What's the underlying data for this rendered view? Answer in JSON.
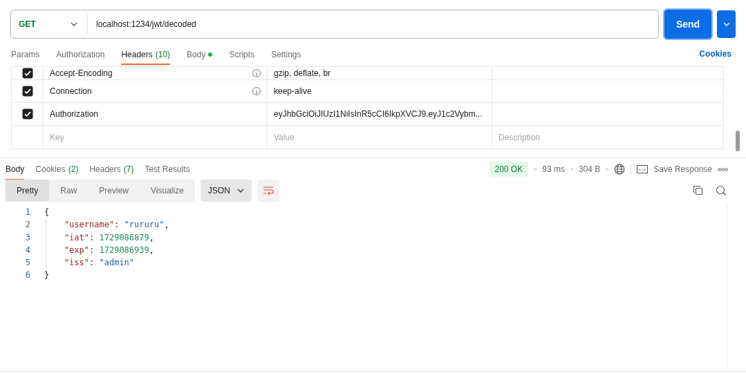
{
  "request": {
    "method": "GET",
    "url": "localhost:1234/jwt/decoded",
    "send": "Send"
  },
  "request_tabs": [
    {
      "label": "Params",
      "dot": false,
      "selected": false
    },
    {
      "label": "Authorization",
      "dot": false,
      "selected": false
    },
    {
      "label": "Headers",
      "count": "(10)",
      "dot": false,
      "selected": true
    },
    {
      "label": "Body",
      "dot": true,
      "selected": false
    },
    {
      "label": "Scripts",
      "dot": false,
      "selected": false
    },
    {
      "label": "Settings",
      "dot": false,
      "selected": false
    }
  ],
  "cookies_link": "Cookies",
  "headers": [
    {
      "checked": true,
      "key": "Accept-Encoding",
      "info": true,
      "value": "gzip, deflate, br"
    },
    {
      "checked": true,
      "key": "Connection",
      "info": true,
      "value": "keep-alive"
    },
    {
      "checked": true,
      "key": "Authorization",
      "info": false,
      "value": "eyJhbGciOiJIUzI1NiIsInR5cCI6IkpXVCJ9.eyJ1c2Vybm..."
    }
  ],
  "new_header": {
    "key_placeholder": "Key",
    "value_placeholder": "Value",
    "description_placeholder": "Description"
  },
  "response_tabs": [
    {
      "label": "Body",
      "selected": true
    },
    {
      "label": "Cookies",
      "count": "(2)",
      "selected": false
    },
    {
      "label": "Headers",
      "count": "(7)",
      "selected": false
    },
    {
      "label": "Test Results",
      "selected": false
    }
  ],
  "status": {
    "code": "200 OK",
    "time": "93 ms",
    "size": "304 B",
    "save": "Save Response"
  },
  "view_modes": [
    {
      "label": "Pretty",
      "selected": true
    },
    {
      "label": "Raw",
      "selected": false
    },
    {
      "label": "Preview",
      "selected": false
    },
    {
      "label": "Visualize",
      "selected": false
    }
  ],
  "format": "JSON",
  "code_lines": [
    [
      {
        "kind": "punct",
        "text": "{"
      }
    ],
    [
      {
        "kind": "key",
        "text": "    \"username\""
      },
      {
        "kind": "punct",
        "text": ": "
      },
      {
        "kind": "string",
        "text": "\"rururu\""
      },
      {
        "kind": "punct",
        "text": ","
      }
    ],
    [
      {
        "kind": "key",
        "text": "    \"iat\""
      },
      {
        "kind": "punct",
        "text": ": "
      },
      {
        "kind": "number",
        "text": "1729086879"
      },
      {
        "kind": "punct",
        "text": ","
      }
    ],
    [
      {
        "kind": "key",
        "text": "    \"exp\""
      },
      {
        "kind": "punct",
        "text": ": "
      },
      {
        "kind": "number",
        "text": "1729086939"
      },
      {
        "kind": "punct",
        "text": ","
      }
    ],
    [
      {
        "kind": "key",
        "text": "    \"iss\""
      },
      {
        "kind": "punct",
        "text": ": "
      },
      {
        "kind": "string",
        "text": "\"admin\""
      }
    ],
    [
      {
        "kind": "punct",
        "text": "}"
      }
    ]
  ],
  "line_numbers": [
    "1",
    "2",
    "3",
    "4",
    "5",
    "6"
  ]
}
